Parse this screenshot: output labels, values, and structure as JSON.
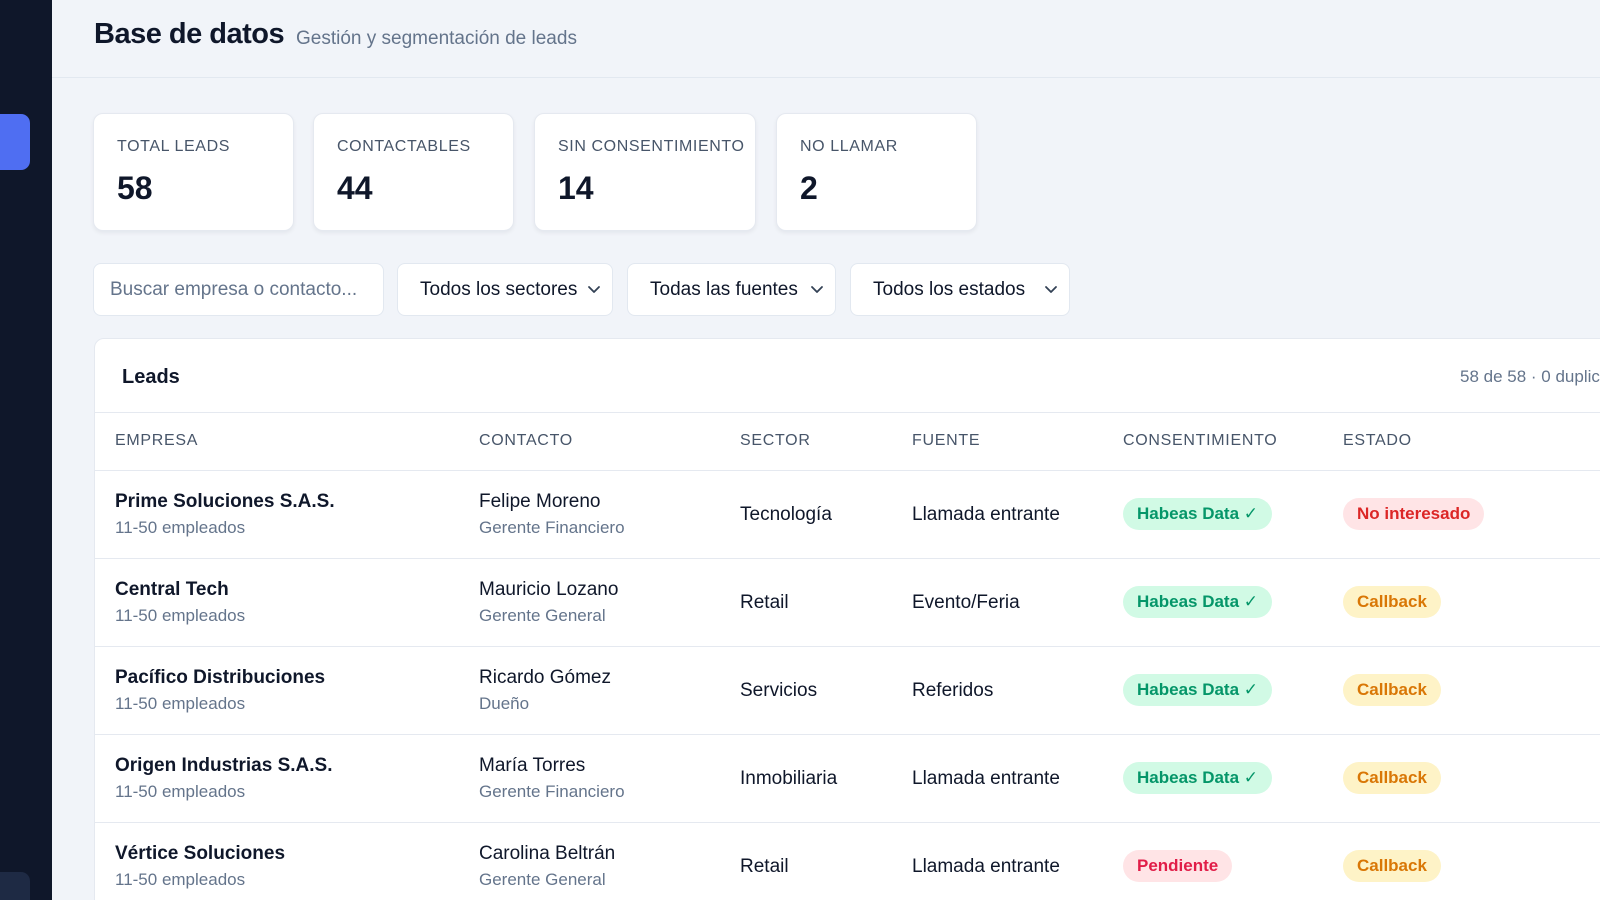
{
  "header": {
    "title": "Base de datos",
    "subtitle": "Gestión y segmentación de leads"
  },
  "stats": [
    {
      "label": "TOTAL LEADS",
      "value": "58"
    },
    {
      "label": "CONTACTABLES",
      "value": "44"
    },
    {
      "label": "SIN CONSENTIMIENTO",
      "value": "14"
    },
    {
      "label": "NO LLAMAR",
      "value": "2"
    }
  ],
  "filters": {
    "search_placeholder": "Buscar empresa o contacto...",
    "sector": "Todos los sectores",
    "source": "Todas las fuentes",
    "status": "Todos los estados"
  },
  "table": {
    "title": "Leads",
    "meta": "58 de 58 · 0 duplic",
    "columns": [
      "EMPRESA",
      "CONTACTO",
      "SECTOR",
      "FUENTE",
      "CONSENTIMIENTO",
      "ESTADO"
    ],
    "rows": [
      {
        "company": "Prime Soluciones S.A.S.",
        "size": "11-50 empleados",
        "contact": "Felipe Moreno",
        "role": "Gerente Financiero",
        "sector": "Tecnología",
        "source": "Llamada entrante",
        "consent": "Habeas Data ✓",
        "status": "No interesado"
      },
      {
        "company": "Central Tech",
        "size": "11-50 empleados",
        "contact": "Mauricio Lozano",
        "role": "Gerente General",
        "sector": "Retail",
        "source": "Evento/Feria",
        "consent": "Habeas Data ✓",
        "status": "Callback"
      },
      {
        "company": "Pacífico Distribuciones",
        "size": "11-50 empleados",
        "contact": "Ricardo Gómez",
        "role": "Dueño",
        "sector": "Servicios",
        "source": "Referidos",
        "consent": "Habeas Data ✓",
        "status": "Callback"
      },
      {
        "company": "Origen Industrias S.A.S.",
        "size": "11-50 empleados",
        "contact": "María Torres",
        "role": "Gerente Financiero",
        "sector": "Inmobiliaria",
        "source": "Llamada entrante",
        "consent": "Habeas Data ✓",
        "status": "Callback"
      },
      {
        "company": "Vértice Soluciones",
        "size": "11-50 empleados",
        "contact": "Carolina Beltrán",
        "role": "Gerente General",
        "sector": "Retail",
        "source": "Llamada entrante",
        "consent": "Pendiente",
        "status": "Callback"
      }
    ]
  },
  "colors": {
    "sidebar": "#0f172a",
    "accent": "#4f6ef2",
    "consent_ok": "#059669",
    "pending": "#e11d48",
    "callback": "#d97706"
  }
}
